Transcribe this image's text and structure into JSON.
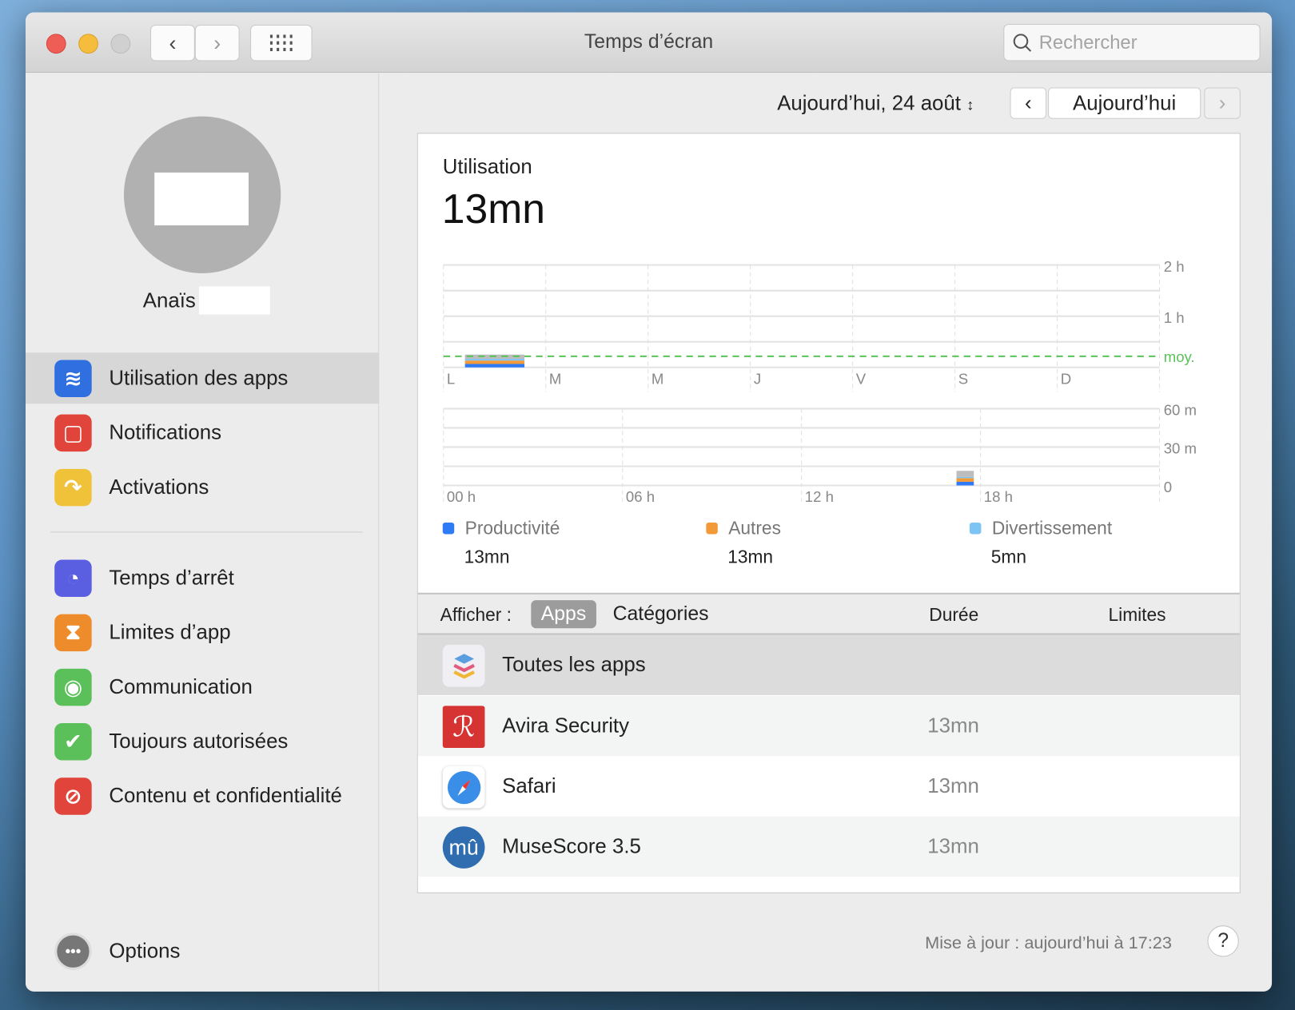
{
  "window": {
    "title": "Temps d’écran",
    "search_placeholder": "Rechercher"
  },
  "user": {
    "name": "Anaïs"
  },
  "sidebar": {
    "items": [
      {
        "label": "Utilisation des apps",
        "icon": "layers-icon",
        "color": "#2f6fe0"
      },
      {
        "label": "Notifications",
        "icon": "notification-icon",
        "color": "#e0443a"
      },
      {
        "label": "Activations",
        "icon": "pickup-icon",
        "color": "#f0c23a"
      },
      {
        "label": "Temps d’arrêt",
        "icon": "downtime-icon",
        "color": "#5a5ee0"
      },
      {
        "label": "Limites d’app",
        "icon": "hourglass-icon",
        "color": "#ee8c2c"
      },
      {
        "label": "Communication",
        "icon": "contact-icon",
        "color": "#5cc05a"
      },
      {
        "label": "Toujours autorisées",
        "icon": "checkmark-badge-icon",
        "color": "#5cc05a"
      },
      {
        "label": "Contenu et confidentialité",
        "icon": "prohibited-icon",
        "color": "#e0443a"
      }
    ],
    "options_label": "Options"
  },
  "header": {
    "date_label": "Aujourd’hui, 24 août",
    "today_button": "Aujourd’hui"
  },
  "usage": {
    "label": "Utilisation",
    "total": "13mn"
  },
  "chart_data": [
    {
      "type": "bar",
      "title": "weekly",
      "categories": [
        "L",
        "M",
        "M",
        "J",
        "V",
        "S",
        "D"
      ],
      "series": [
        {
          "name": "Productivité",
          "values": [
            4,
            0,
            0,
            0,
            0,
            0,
            0
          ]
        },
        {
          "name": "Autres",
          "values": [
            4,
            0,
            0,
            0,
            0,
            0,
            0
          ]
        },
        {
          "name": "Divertissement",
          "values": [
            2,
            0,
            0,
            0,
            0,
            0,
            0
          ]
        },
        {
          "name": "Autre",
          "values": [
            5,
            0,
            0,
            0,
            0,
            0,
            0
          ]
        }
      ],
      "yticks": [
        "2 h",
        "1 h"
      ],
      "ylim": [
        0,
        120
      ],
      "average_minutes": 13,
      "average_label": "moy.",
      "colors": [
        "#2f7af5",
        "#f29a37",
        "#7cc4f4",
        "#bdbdbd"
      ]
    },
    {
      "type": "bar",
      "title": "hourly",
      "xticks": [
        "00 h",
        "06 h",
        "12 h",
        "18 h"
      ],
      "yticks": [
        "60 m",
        "30 m",
        "0"
      ],
      "ylim": [
        0,
        60
      ],
      "bars": [
        {
          "hour": 17,
          "segments": [
            3,
            3,
            1,
            5
          ]
        }
      ],
      "colors": [
        "#2f7af5",
        "#f29a37",
        "#7cc4f4",
        "#bdbdbd"
      ]
    }
  ],
  "legend": [
    {
      "name": "Productivité",
      "value": "13mn",
      "color": "#2f7af5"
    },
    {
      "name": "Autres",
      "value": "13mn",
      "color": "#f29a37"
    },
    {
      "name": "Divertissement",
      "value": "5mn",
      "color": "#7cc4f4"
    }
  ],
  "table": {
    "show_label": "Afficher :",
    "seg_apps": "Apps",
    "seg_categories": "Catégories",
    "col_duration": "Durée",
    "col_limits": "Limites",
    "rows": [
      {
        "name": "Toutes les apps",
        "duration": ""
      },
      {
        "name": "Avira Security",
        "duration": "13mn"
      },
      {
        "name": "Safari",
        "duration": "13mn"
      },
      {
        "name": "MuseScore 3.5",
        "duration": "13mn"
      }
    ]
  },
  "footer": {
    "updated": "Mise à jour : aujourd’hui à 17:23",
    "help": "?"
  }
}
